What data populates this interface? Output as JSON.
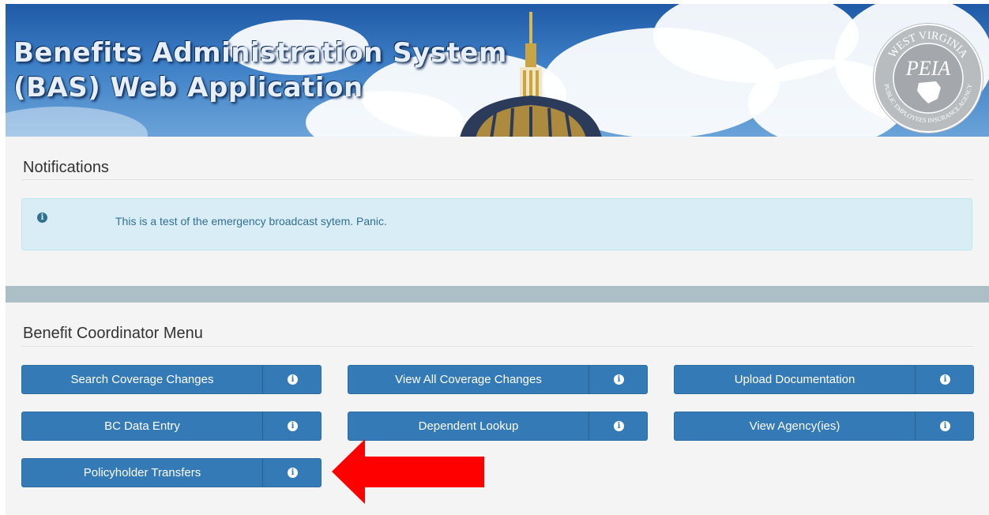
{
  "banner": {
    "title": "Benefits Administration System\n(BAS) Web Application",
    "seal": {
      "top_text": "WEST VIRGINIA",
      "center_text": "PEIA",
      "bottom_text": "PUBLIC EMPLOYEES INSURANCE AGENCY"
    }
  },
  "notifications": {
    "heading": "Notifications",
    "alert_icon": "info-circle-icon",
    "message": "This is a test of the emergency broadcast sytem. Panic."
  },
  "menu": {
    "heading": "Benefit Coordinator Menu",
    "info_icon": "info-circle-icon",
    "buttons": [
      {
        "label": "Search Coverage Changes"
      },
      {
        "label": "View All Coverage Changes"
      },
      {
        "label": "Upload Documentation"
      },
      {
        "label": "BC Data Entry"
      },
      {
        "label": "Dependent Lookup"
      },
      {
        "label": "View Agency(ies)"
      },
      {
        "label": "Policyholder Transfers"
      }
    ]
  },
  "annotation": {
    "arrow_icon": "red-left-arrow-icon",
    "arrow_color": "#ff0000"
  },
  "colors": {
    "button_primary": "#337ab7",
    "alert_bg": "#d9edf7",
    "alert_text": "#31708f",
    "divider": "#acbfc6"
  }
}
